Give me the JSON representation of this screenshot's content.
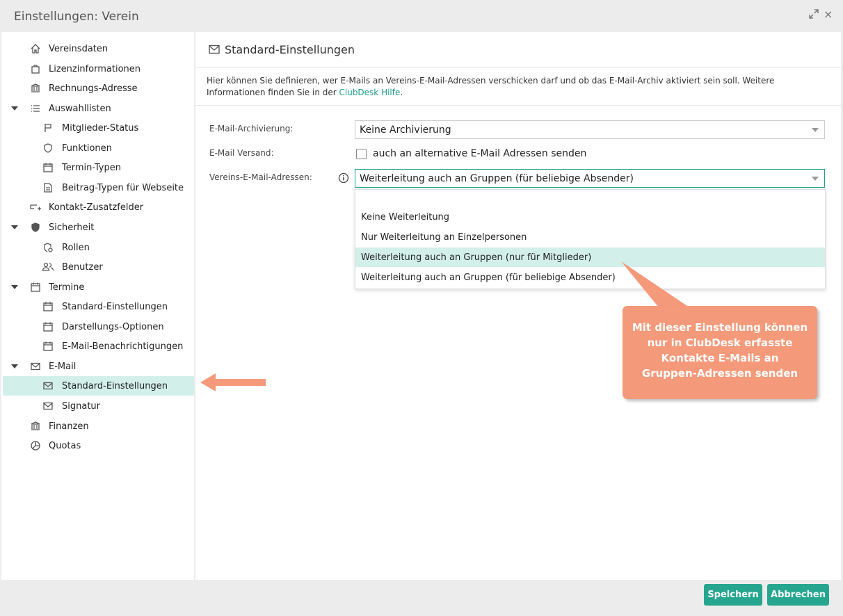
{
  "window": {
    "title": "Einstellungen: Verein",
    "expand_icon": "expand-arrows-icon",
    "close_label": "×"
  },
  "sidebar": {
    "vereinsdaten": "Vereinsdaten",
    "lizenzinformationen": "Lizenzinformationen",
    "rechnungs_adresse": "Rechnungs-Adresse",
    "auswahllisten": "Auswahllisten",
    "mitglieder_status": "Mitglieder-Status",
    "funktionen": "Funktionen",
    "termin_typen": "Termin-Typen",
    "beitrag_typen": "Beitrag-Typen für Webseite",
    "kontakt_zusatzfelder": "Kontakt-Zusatzfelder",
    "sicherheit": "Sicherheit",
    "rollen": "Rollen",
    "benutzer": "Benutzer",
    "termine": "Termine",
    "termine_standard": "Standard-Einstellungen",
    "darstellungs_optionen": "Darstellungs-Optionen",
    "email_benachrichtigungen": "E-Mail-Benachrichtigungen",
    "email": "E-Mail",
    "email_standard": "Standard-Einstellungen",
    "signatur": "Signatur",
    "finanzen": "Finanzen",
    "quotas": "Quotas"
  },
  "main": {
    "title": "Standard-Einstellungen",
    "description": "Hier können Sie definieren, wer E-Mails an Vereins-E-Mail-Adressen verschicken darf und ob das E-Mail-Archiv aktiviert sein soll. Weitere Informationen finden Sie in der ",
    "help_link": "ClubDesk Hilfe",
    "description_end": "."
  },
  "form": {
    "archivierung_label": "E-Mail-Archivierung:",
    "archivierung_value": "Keine Archivierung",
    "versand_label": "E-Mail Versand:",
    "versand_checkbox_label": "auch an alternative E-Mail Adressen senden",
    "versand_checked": false,
    "adressen_label": "Vereins-E-Mail-Adressen:",
    "adressen_value": "Weiterleitung auch an Gruppen (für beliebige Absender)",
    "adressen_options": [
      "Keine Weiterleitung",
      "Nur Weiterleitung an Einzelpersonen",
      "Weiterleitung auch an Gruppen (nur für Mitglieder)",
      "Weiterleitung auch an Gruppen (für beliebige Absender)"
    ]
  },
  "callout": {
    "line1": "Mit dieser Einstellung können",
    "line2": "nur in ClubDesk erfasste",
    "line3": "Kontakte E-Mails an",
    "line4": "Gruppen-Adressen senden"
  },
  "buttons": {
    "save": "Speichern",
    "cancel": "Abbrechen"
  },
  "colors": {
    "accent": "#26a68f",
    "selection": "#d3efea",
    "callout": "#f4997a"
  }
}
